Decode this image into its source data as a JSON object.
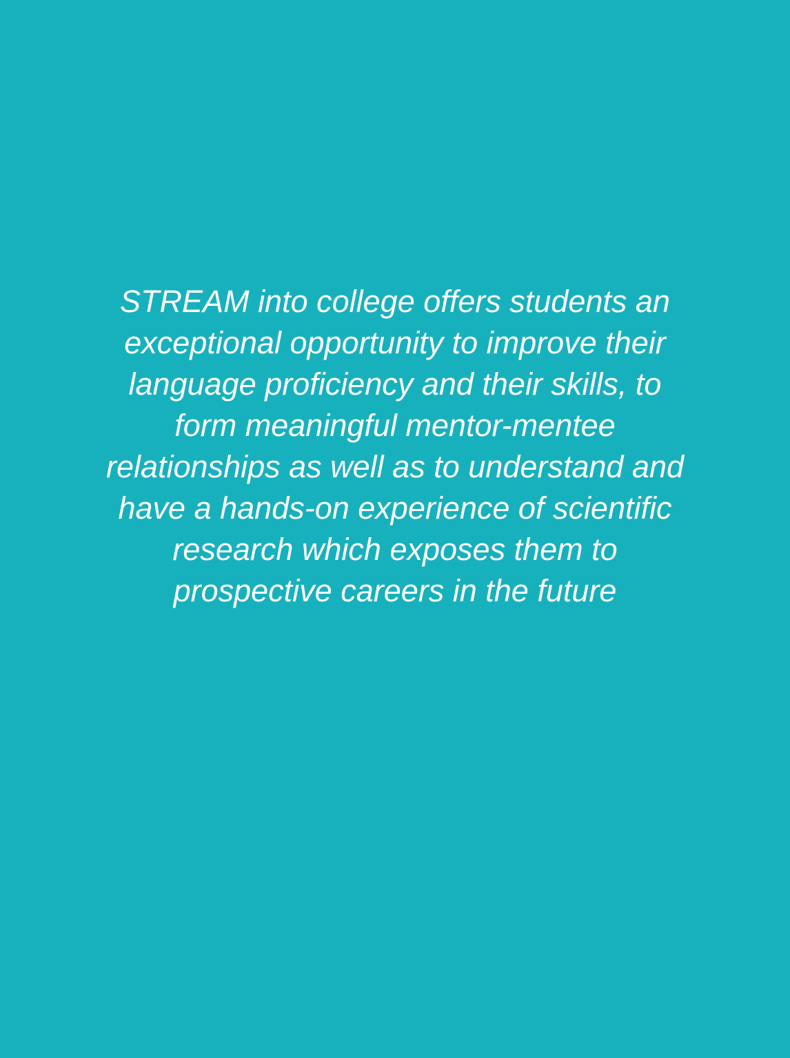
{
  "colors": {
    "background": "#17b1bd",
    "text": "#ffffff"
  },
  "paragraph": {
    "lines": [
      "STREAM into college offers students an",
      "exceptional opportunity to improve their",
      "language proficiency and their skills, to",
      "form meaningful mentor-mentee",
      "relationships as well as to understand and",
      "have a hands-on experience of scientific",
      "research which exposes them to",
      "prospective careers in the future"
    ]
  }
}
